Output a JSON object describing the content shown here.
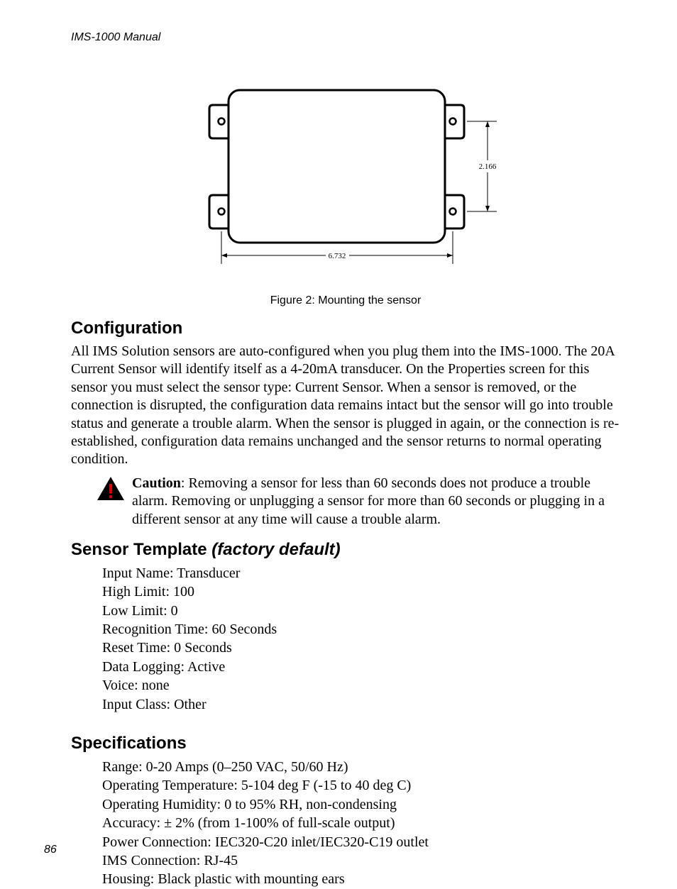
{
  "header": {
    "title": "IMS-1000 Manual"
  },
  "figure": {
    "caption": "Figure 2: Mounting the sensor",
    "dim_v": "2.166",
    "dim_h": "6.732"
  },
  "sections": {
    "config": {
      "heading": "Configuration",
      "body": "All IMS Solution sensors are auto-configured when you plug them into the IMS-1000. The 20A Current Sensor will identify itself as a 4-20mA transducer. On the Properties screen for this sensor you must select the sensor type: Current Sensor. When a sensor is removed, or the connection is disrupted, the configuration data remains intact but the sensor will go into trouble status and generate a trouble alarm. When the sensor is plugged in again, or the connection is re-established, configuration data remains unchanged and the sensor returns to normal operating condition."
    },
    "caution": {
      "label": "Caution",
      "text": ": Removing a sensor for less than 60 seconds does not produce a trouble alarm. Removing or unplugging a sensor for more than 60 seconds or plugging in a different sensor at any time will cause a trouble alarm."
    },
    "template": {
      "heading": "Sensor Template ",
      "heading_ital": "(factory default)",
      "items": [
        "Input Name: Transducer",
        "High Limit: 100",
        "Low Limit: 0",
        "Recognition Time: 60 Seconds",
        "Reset Time: 0 Seconds",
        "Data Logging: Active",
        "Voice: none",
        "Input Class: Other"
      ]
    },
    "specs": {
      "heading": "Specifications",
      "items": [
        "Range: 0-20 Amps (0–250 VAC, 50/60 Hz)",
        "Operating Temperature: 5-104 deg F (-15 to 40 deg C)",
        "Operating Humidity: 0 to 95% RH, non-condensing",
        "Accuracy: ± 2%  (from 1-100% of full-scale output)",
        "Power Connection: IEC320-C20 inlet/IEC320-C19 outlet",
        "IMS Connection: RJ-45",
        "Housing: Black plastic with mounting ears"
      ]
    }
  },
  "page_number": "86"
}
